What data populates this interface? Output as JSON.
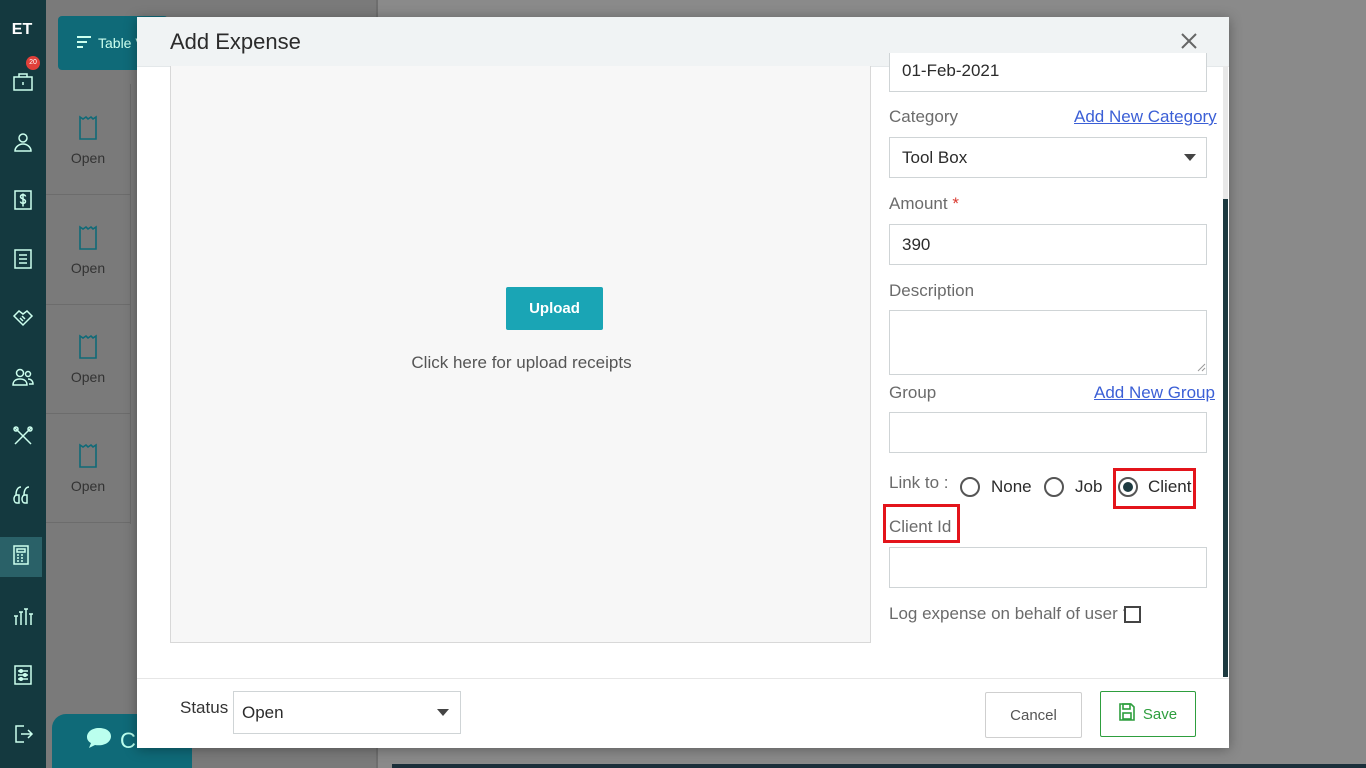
{
  "app": {
    "logo_text": "ET",
    "notification_count": "20"
  },
  "background": {
    "table_view_label": "Table V",
    "rows": [
      {
        "label": "Open"
      },
      {
        "label": "Open"
      },
      {
        "label": "Open"
      },
      {
        "label": "Open"
      }
    ],
    "chat_label": "Ch"
  },
  "nav_icons": [
    "briefcase-icon",
    "user-icon",
    "dollar-icon",
    "list-icon",
    "handshake-icon",
    "users-icon",
    "tools-icon",
    "leads-icon",
    "calculator-icon",
    "reports-icon",
    "settings-icon",
    "logout-icon"
  ],
  "modal": {
    "title": "Add Expense",
    "upload": {
      "button_label": "Upload",
      "hint": "Click here for upload receipts"
    },
    "form": {
      "date_value": "01-Feb-2021",
      "category_label": "Category",
      "add_category_link": "Add New Category",
      "category_value": "Tool Box",
      "amount_label": "Amount",
      "amount_required": "*",
      "amount_value": "390",
      "description_label": "Description",
      "description_value": "",
      "group_label": "Group",
      "add_group_link": "Add New Group",
      "group_value": "",
      "link_to_label": "Link to :",
      "link_options": [
        {
          "label": "None",
          "checked": false
        },
        {
          "label": "Job",
          "checked": false
        },
        {
          "label": "Client",
          "checked": true
        }
      ],
      "client_id_label": "Client Id",
      "client_id_value": "",
      "behalf_label": "Log expense on behalf of user ?",
      "behalf_checked": false
    },
    "footer": {
      "status_label": "Status",
      "status_value": "Open",
      "cancel_label": "Cancel",
      "save_label": "Save"
    }
  },
  "colors": {
    "accent": "#1aa5b5",
    "save": "#2e9e3e",
    "highlight": "#e3141b",
    "nav": "#14393f"
  }
}
